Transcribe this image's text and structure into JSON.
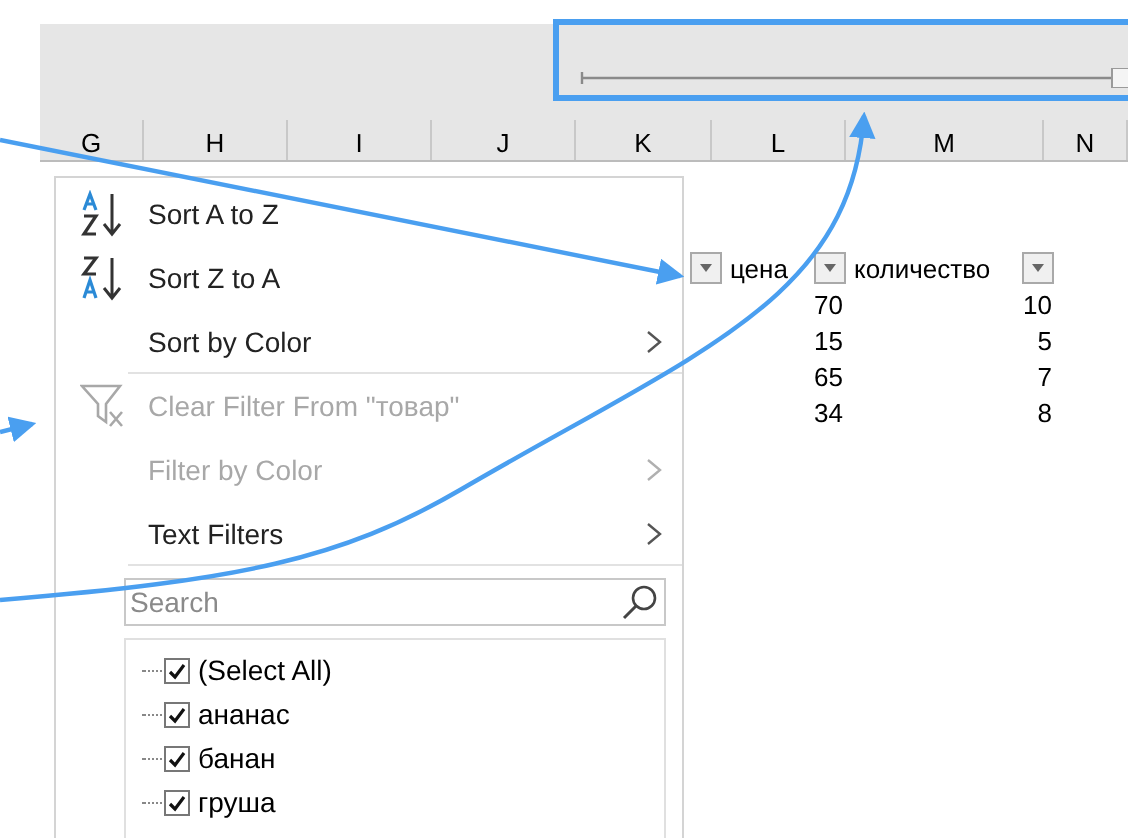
{
  "columns": [
    "G",
    "H",
    "I",
    "J",
    "K",
    "L",
    "M",
    "N"
  ],
  "menu": {
    "items": [
      {
        "kind": "sort_az",
        "label": "Sort A to Z",
        "disabled": false,
        "submenu": false,
        "divider_after": false
      },
      {
        "kind": "sort_za",
        "label": "Sort Z to A",
        "disabled": false,
        "submenu": false,
        "divider_after": false
      },
      {
        "kind": "plain",
        "label": "Sort by Color",
        "disabled": false,
        "submenu": true,
        "divider_after": true
      },
      {
        "kind": "clear_filter",
        "label": "Clear Filter From \"товар\"",
        "disabled": true,
        "submenu": false,
        "divider_after": false
      },
      {
        "kind": "plain",
        "label": "Filter by Color",
        "disabled": true,
        "submenu": true,
        "divider_after": false
      },
      {
        "kind": "plain",
        "label": "Text Filters",
        "disabled": false,
        "submenu": true,
        "divider_after": true
      }
    ],
    "search": {
      "placeholder": "Search"
    },
    "values": [
      {
        "label": "(Select All)",
        "checked": true
      },
      {
        "label": "ананас",
        "checked": true
      },
      {
        "label": "банан",
        "checked": true
      },
      {
        "label": "груша",
        "checked": true
      }
    ]
  },
  "table": {
    "headers": [
      "цена",
      "количество"
    ],
    "rows": [
      [
        "70",
        "10"
      ],
      [
        "15",
        "5"
      ],
      [
        "65",
        "7"
      ],
      [
        "34",
        "8"
      ]
    ]
  }
}
